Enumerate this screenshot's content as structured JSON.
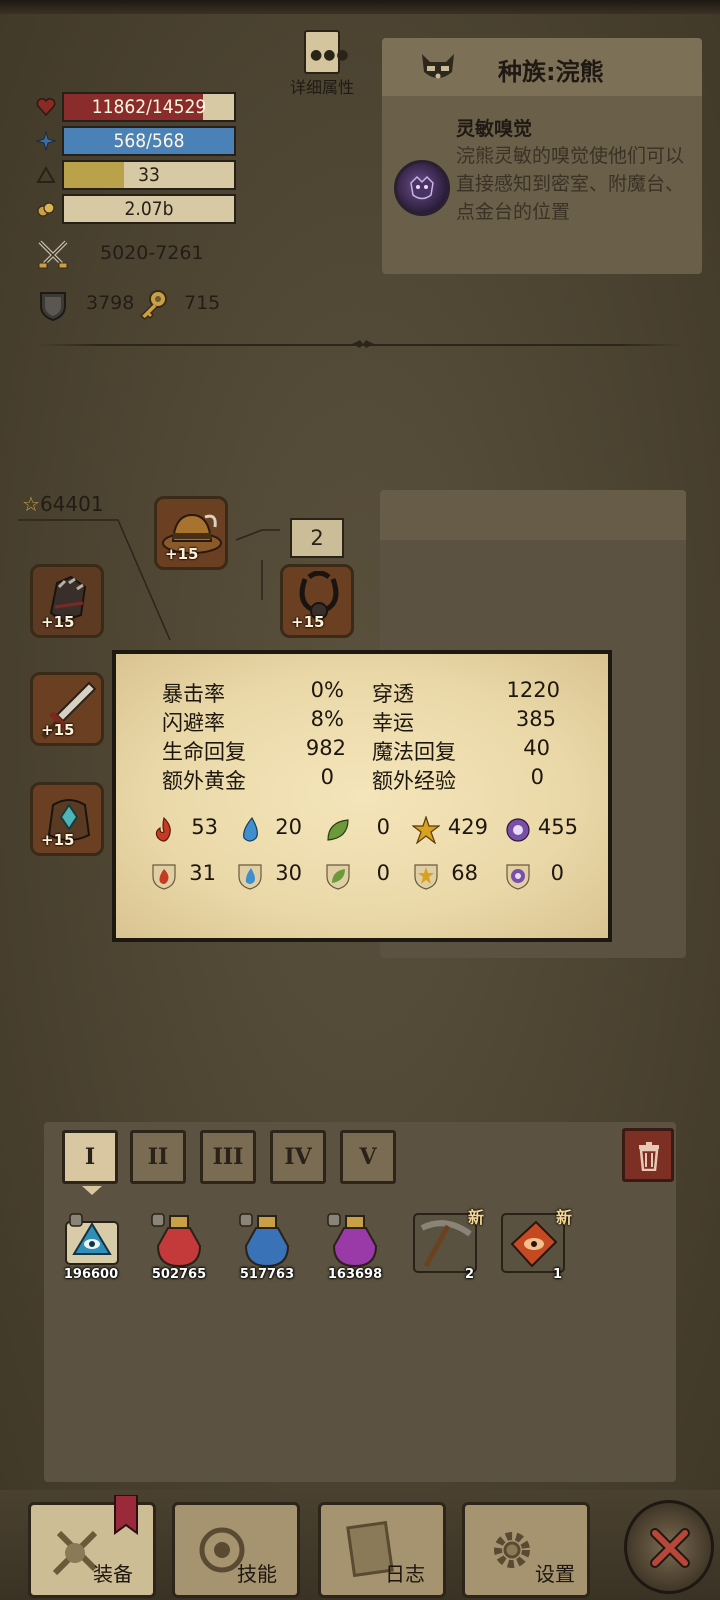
{
  "stats": {
    "hp": "11862/14529",
    "hp_fraction": 0.816,
    "mp": "568/568",
    "mp_fraction": 1.0,
    "level": "33",
    "level_fraction": 0.35,
    "gold": "2.07b",
    "attack": "5020-7261",
    "defense": "3798",
    "keys": "715"
  },
  "detail_button": {
    "label": "详细属性"
  },
  "race": {
    "title": "种族:浣熊",
    "trait_title": "灵敏嗅觉",
    "trait_desc": "浣熊灵敏的嗅觉使他们可以直接感知到密室、附魔台、点金台的位置"
  },
  "equipment": {
    "score": "64401",
    "level_box": "2",
    "slots": [
      {
        "name": "helmet",
        "plus": "+15"
      },
      {
        "name": "glove",
        "plus": "+15"
      },
      {
        "name": "amulet",
        "plus": "+15"
      },
      {
        "name": "sword",
        "plus": "+15"
      },
      {
        "name": "bracer",
        "plus": "+15"
      }
    ]
  },
  "popup": {
    "rows": [
      {
        "k1": "暴击率",
        "v1": "0%",
        "k2": "穿透",
        "v2": "1220"
      },
      {
        "k1": "闪避率",
        "v1": "8%",
        "k2": "幸运",
        "v2": "385"
      },
      {
        "k1": "生命回复",
        "v1": "982",
        "k2": "魔法回复",
        "v2": "40"
      },
      {
        "k1": "额外黄金",
        "v1": "0",
        "k2": "额外经验",
        "v2": "0"
      }
    ],
    "attack_elements": [
      "53",
      "20",
      "0",
      "429",
      "455"
    ],
    "resist_elements": [
      "31",
      "30",
      "0",
      "68",
      "0"
    ],
    "element_icons": [
      "fire-icon",
      "water-icon",
      "leaf-icon",
      "lightning-icon",
      "arcane-icon"
    ],
    "element_colors": [
      "#c43a22",
      "#3f8fcf",
      "#6c9a3a",
      "#d6a21f",
      "#7a4fa8"
    ]
  },
  "inventory": {
    "tabs": [
      "I",
      "II",
      "III",
      "IV",
      "V"
    ],
    "items": [
      {
        "name": "scroll",
        "count": "196600"
      },
      {
        "name": "red-potion",
        "count": "502765"
      },
      {
        "name": "blue-potion",
        "count": "517763"
      },
      {
        "name": "purple-potion",
        "count": "163698"
      },
      {
        "name": "pickaxe",
        "count": "2",
        "tag": "新"
      },
      {
        "name": "monster-eye",
        "count": "1",
        "tag": "新"
      }
    ]
  },
  "nav": {
    "equip": "装备",
    "skills": "技能",
    "log": "日志",
    "settings": "设置"
  }
}
